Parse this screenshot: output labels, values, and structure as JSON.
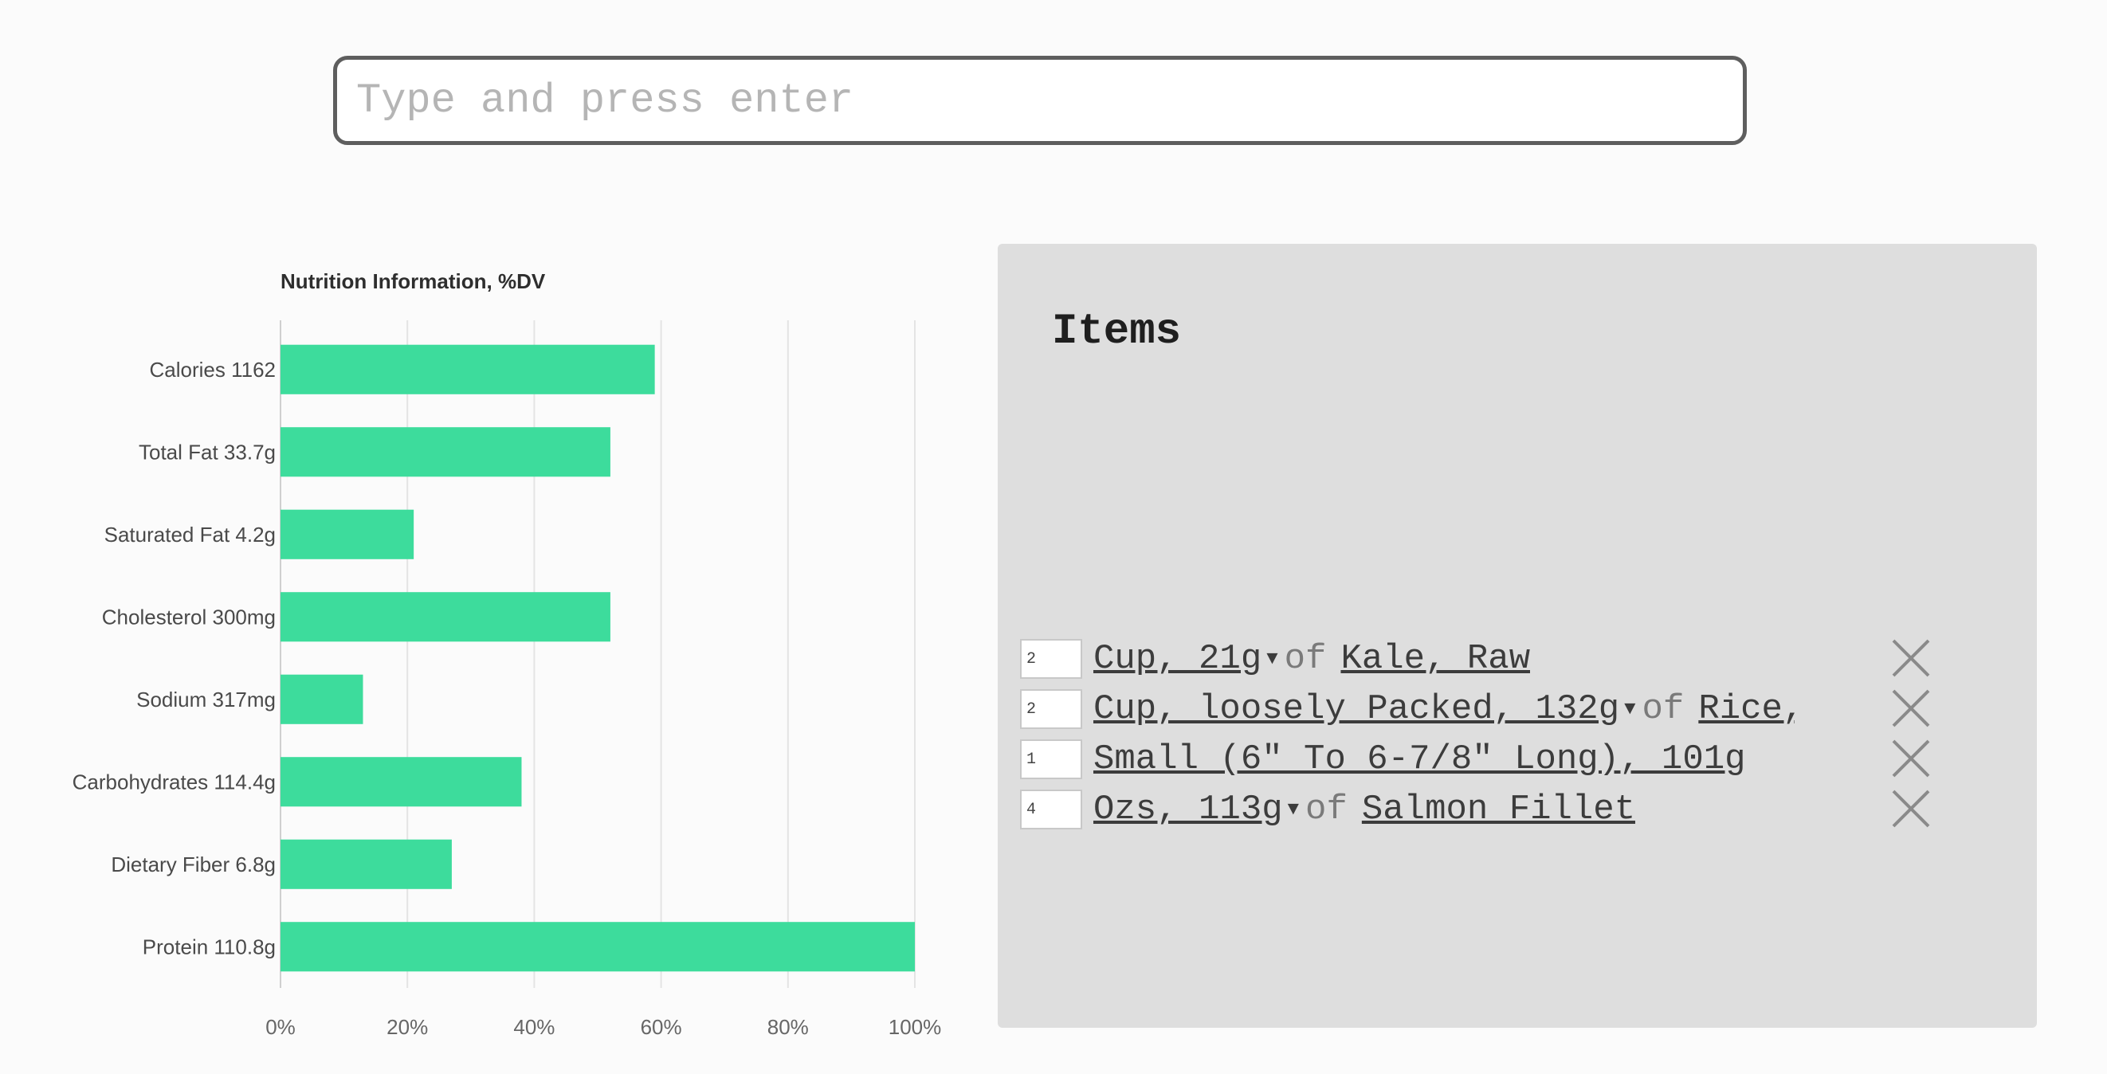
{
  "search": {
    "placeholder": "Type and press enter",
    "value": ""
  },
  "chart_data": {
    "type": "bar",
    "orientation": "horizontal",
    "title": "Nutrition Information, %DV",
    "categories": [
      "Calories 1162",
      "Total Fat 33.7g",
      "Saturated Fat 4.2g",
      "Cholesterol 300mg",
      "Sodium 317mg",
      "Carbohydrates 114.4g",
      "Dietary Fiber 6.8g",
      "Protein 110.8g"
    ],
    "values": [
      59,
      52,
      21,
      52,
      13,
      38,
      27,
      100
    ],
    "xlim": [
      0,
      100
    ],
    "ticks": [
      "0%",
      "20%",
      "40%",
      "60%",
      "80%",
      "100%"
    ],
    "xlabel": "",
    "ylabel": "",
    "grid": true,
    "color": "#3ddc9c"
  },
  "items_panel": {
    "title": "Items",
    "items": [
      {
        "qty": "2",
        "serving": "Cup, 21g",
        "has_dropdown": true,
        "of": "of",
        "food": "Kale, Raw"
      },
      {
        "qty": "2",
        "serving": "Cup, loosely Packed, 132g",
        "has_dropdown": true,
        "of": "of",
        "food": "Rice, ..."
      },
      {
        "qty": "1",
        "serving": "Small (6\" To 6-7/8\" Long), 101g",
        "has_dropdown": false,
        "of": "",
        "food": ""
      },
      {
        "qty": "4",
        "serving": "Ozs, 113g",
        "has_dropdown": true,
        "of": "of",
        "food": "Salmon Fillet"
      }
    ]
  },
  "icons": {
    "remove": "close-icon",
    "dropdown": "caret-down-icon"
  }
}
